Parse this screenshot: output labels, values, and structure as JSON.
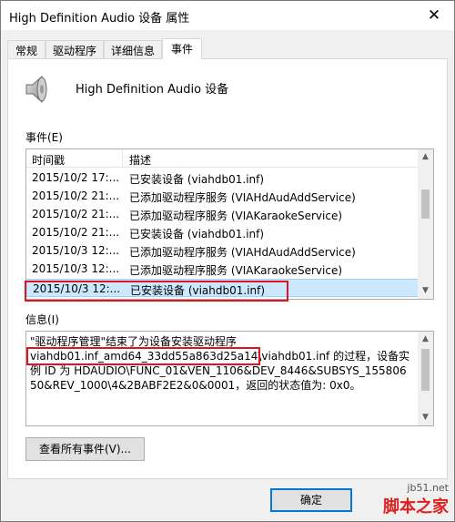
{
  "window": {
    "title": "High Definition Audio 设备 属性",
    "close_glyph": "✕"
  },
  "tabs": [
    {
      "label": "常规",
      "active": false
    },
    {
      "label": "驱动程序",
      "active": false
    },
    {
      "label": "详细信息",
      "active": false
    },
    {
      "label": "事件",
      "active": true
    }
  ],
  "device": {
    "icon": "speaker-icon",
    "name": "High Definition Audio 设备"
  },
  "events": {
    "label": "事件(E)",
    "columns": [
      "时间戳",
      "描述"
    ],
    "rows": [
      {
        "time": "2015/10/2 17:...",
        "desc": "已安装设备 (viahdb01.inf)"
      },
      {
        "time": "2015/10/2 21:...",
        "desc": "已添加驱动程序服务 (VIAHdAudAddService)"
      },
      {
        "time": "2015/10/2 21:...",
        "desc": "已添加驱动程序服务 (VIAKaraokeService)"
      },
      {
        "time": "2015/10/2 21:...",
        "desc": "已安装设备 (viahdb01.inf)"
      },
      {
        "time": "2015/10/3 12:...",
        "desc": "已添加驱动程序服务 (VIAHdAudAddService)"
      },
      {
        "time": "2015/10/3 12:...",
        "desc": "已添加驱动程序服务 (VIAKaraokeService)"
      },
      {
        "time": "2015/10/3 12:...",
        "desc": "已安装设备 (viahdb01.inf)",
        "selected": true
      }
    ]
  },
  "info": {
    "label": "信息(I)",
    "line1": "\"驱动程序管理\"结束了为设备安装驱动程序",
    "line2_highlight": "viahdb01.inf_amd64_33dd55a863d25a14",
    "line2_rest": "\\viahdb01.inf 的过程，设备实例 ID 为 HDAUDIO\\FUNC_01&VEN_1106&DEV_8446&SUBSYS_15580650&REV_1000\\4&2BABF2E2&0&0001，返回的状态值为: 0x0。"
  },
  "buttons": {
    "view_all": "查看所有事件(V)...",
    "ok": "确定"
  },
  "watermark": {
    "top": "jb51.net",
    "main": "脚本之家"
  },
  "colors": {
    "highlight": "#e0141e",
    "selection": "#cce8ff",
    "default_button": "#0078d7"
  }
}
